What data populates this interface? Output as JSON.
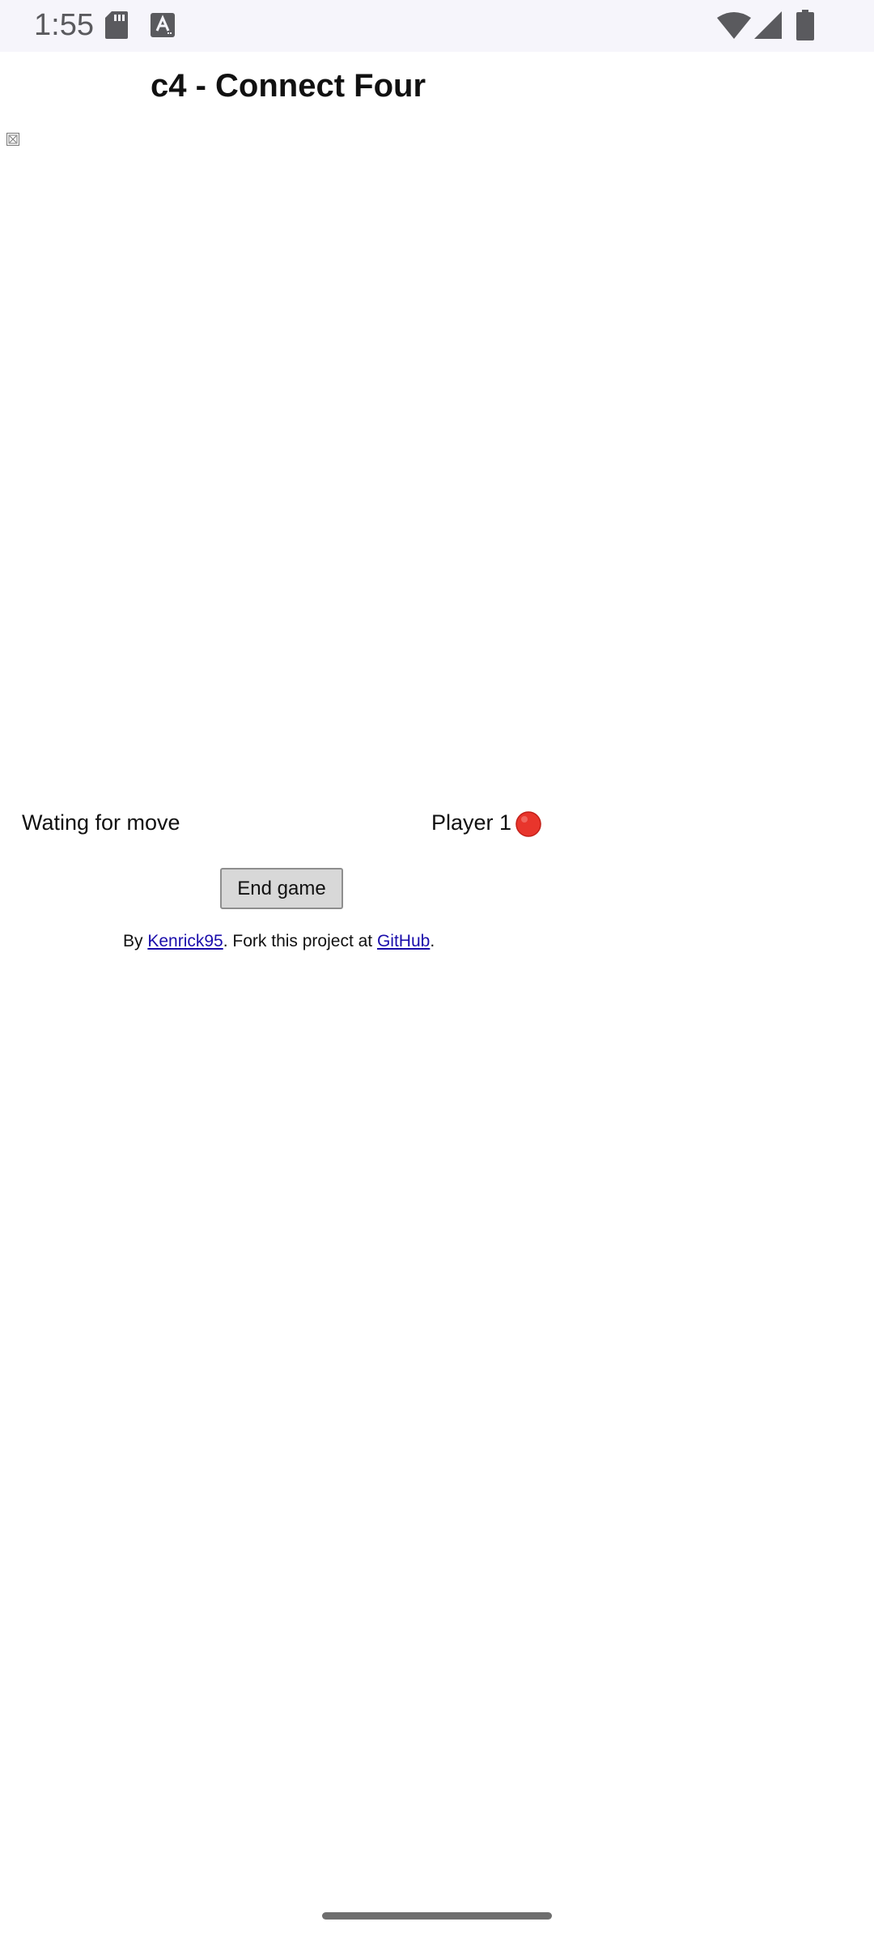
{
  "status_bar": {
    "time": "1:55",
    "icons": [
      "sd-card-icon",
      "text-a-icon",
      "wifi-icon",
      "cell-signal-icon",
      "battery-icon"
    ]
  },
  "page": {
    "title": "c4 - Connect Four"
  },
  "game": {
    "status_text": "Wating for move",
    "player_label": "Player 1",
    "player_color": "#e8352c",
    "end_button_label": "End game"
  },
  "footer": {
    "by_prefix": "By ",
    "author_link": "Kenrick95",
    "middle_text": ". Fork this project at ",
    "repo_link": "GitHub",
    "suffix": "."
  }
}
